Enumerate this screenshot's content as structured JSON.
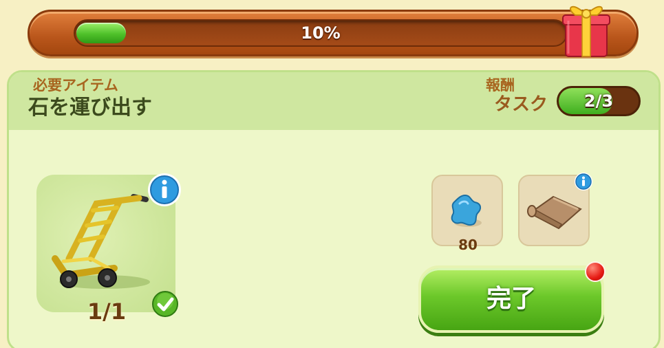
{
  "progress": {
    "label": "10%",
    "value": 0.1
  },
  "task": {
    "title": "石を運び出す",
    "counter_label": "タスク",
    "counter_value": "2/3",
    "counter_fraction": 0.6667
  },
  "required": {
    "label": "必要アイテム",
    "items": [
      {
        "icon": "hand-truck-icon",
        "count": "1/1",
        "completed": true
      }
    ]
  },
  "rewards": {
    "label": "報酬",
    "items": [
      {
        "icon": "blue-star-gem-icon",
        "count": "80"
      },
      {
        "icon": "cloth-roll-icon",
        "count": ""
      }
    ]
  },
  "complete_button": {
    "label": "完了",
    "has_notification": true
  },
  "colors": {
    "progress_green": "#4fc12a",
    "bar_orange": "#b9561b",
    "header_green": "#cfe7a0",
    "panel_bg": "#eef7c9",
    "button_green": "#6cc82a",
    "label_brown": "#a8651f",
    "notification_red": "#e61b14"
  }
}
